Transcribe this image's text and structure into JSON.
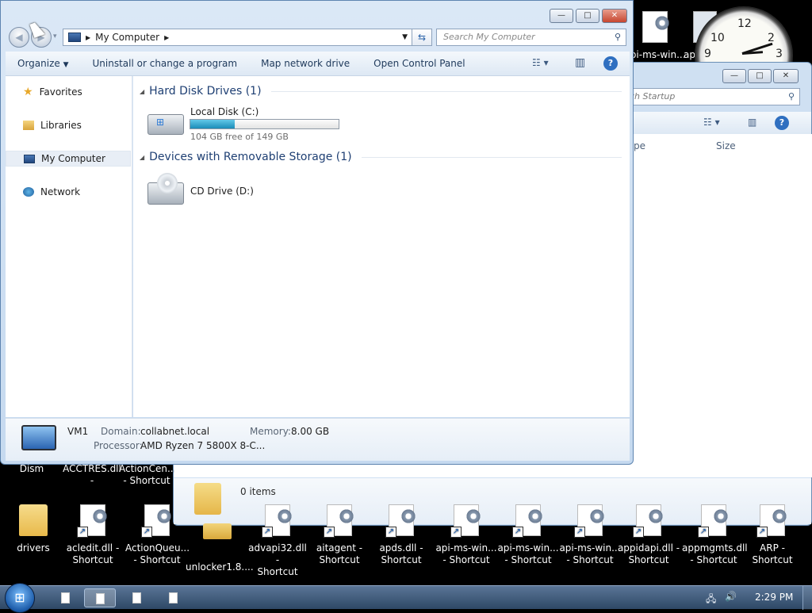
{
  "desktop": {
    "top_labels": [
      {
        "text": "Dism"
      },
      {
        "text": "ACCTRES.dll -\nShortcut"
      },
      {
        "text": "ActionCen...\n- Shortcut"
      }
    ],
    "bottom_icons": [
      {
        "label": "drivers",
        "kind": "folder"
      },
      {
        "label": "acledit.dll -\nShortcut",
        "kind": "dll"
      },
      {
        "label": "ActionQueu...\n- Shortcut",
        "kind": "dll"
      },
      {
        "label": "unlocker1.8....",
        "kind": "zip"
      },
      {
        "label": "advapi32.dll -\nShortcut",
        "kind": "dll"
      },
      {
        "label": "aitagent -\nShortcut",
        "kind": "exe"
      },
      {
        "label": "apds.dll -\nShortcut",
        "kind": "dll"
      },
      {
        "label": "api-ms-win...\n- Shortcut",
        "kind": "dll"
      },
      {
        "label": "api-ms-win...\n- Shortcut",
        "kind": "dll"
      },
      {
        "label": "api-ms-win...\n- Shortcut",
        "kind": "dll"
      },
      {
        "label": "appidapi.dll -\nShortcut",
        "kind": "dll"
      },
      {
        "label": "appmgmts.dll\n- Shortcut",
        "kind": "dll"
      },
      {
        "label": "ARP -\nShortcut",
        "kind": "exe"
      }
    ],
    "top_right_icon_label": "api-ms-win...",
    "top_right_icon_label2": "ap",
    "clock_numbers": [
      "12",
      "2",
      "3",
      "9",
      "10"
    ]
  },
  "back_window": {
    "search_partial": "ch Startup",
    "col_type_partial": "pe",
    "col_size": "Size",
    "status": "0 items"
  },
  "explorer": {
    "caption_buttons": {
      "minimize": "—",
      "maximize": "□",
      "close": "✕"
    },
    "address": {
      "root": "My Computer"
    },
    "search_placeholder": "Search My Computer",
    "toolbar": {
      "organize": "Organize",
      "uninstall": "Uninstall or change a program",
      "map_drive": "Map network drive",
      "control_panel": "Open Control Panel"
    },
    "nav": {
      "favorites": "Favorites",
      "libraries": "Libraries",
      "my_computer": "My Computer",
      "network": "Network"
    },
    "groups": {
      "hdd": "Hard Disk Drives (1)",
      "removable": "Devices with Removable Storage (1)"
    },
    "drives": {
      "c_name": "Local Disk (C:)",
      "c_free": "104 GB free of 149 GB",
      "c_used_fraction": 0.3,
      "d_name": "CD Drive (D:)"
    },
    "details": {
      "name": "VM1",
      "domain_label": "Domain:",
      "domain_value": "collabnet.local",
      "memory_label": "Memory:",
      "memory_value": "8.00 GB",
      "processor_label": "Processor:",
      "processor_value": "AMD Ryzen 7 5800X 8-C..."
    }
  },
  "taskbar": {
    "time": "2:29 PM"
  },
  "colors": {
    "accent_bar": "#2aa0c8",
    "group_header": "#1e3f73",
    "taskbar": "#2e4866"
  }
}
